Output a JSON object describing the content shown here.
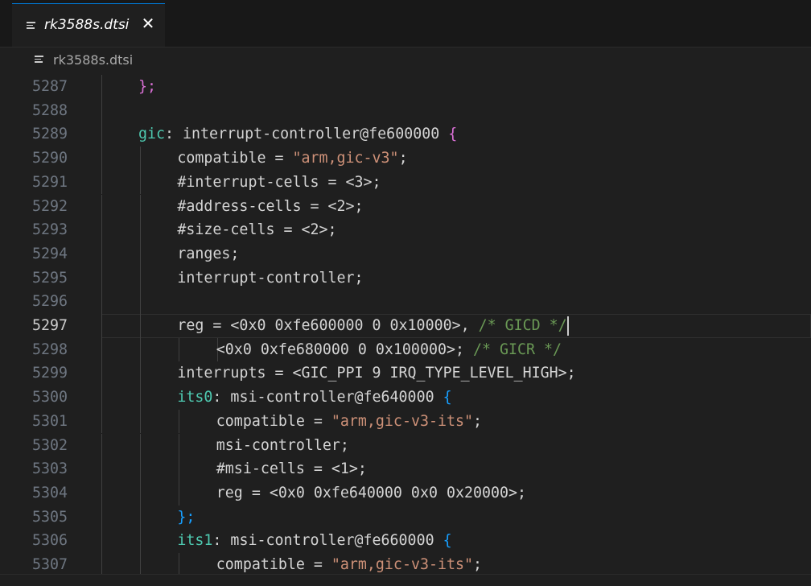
{
  "tab": {
    "label": "rk3588s.dtsi",
    "close_glyph": "✕",
    "icon": "lines-file-icon"
  },
  "breadcrumb": {
    "label": "rk3588s.dtsi",
    "icon": "lines-file-icon"
  },
  "editor": {
    "current_line": "5297",
    "lines": [
      {
        "num": "5287",
        "segments": [
          {
            "t": "};",
            "c": "b2"
          }
        ]
      },
      {
        "num": "5288",
        "segments": []
      },
      {
        "num": "5289",
        "segments": [
          {
            "t": "gic",
            "c": "t-label"
          },
          {
            "t": ": interrupt-controller@fe600000 ",
            "c": "t-ident"
          },
          {
            "t": "{",
            "c": "b2"
          }
        ]
      },
      {
        "num": "5290",
        "segments": [
          {
            "t": "compatible = ",
            "c": "t-ident"
          },
          {
            "t": "\"arm,gic-v3\"",
            "c": "t-str"
          },
          {
            "t": ";",
            "c": "t-punct"
          }
        ]
      },
      {
        "num": "5291",
        "segments": [
          {
            "t": "#interrupt-cells = <3>;",
            "c": "t-ident"
          }
        ]
      },
      {
        "num": "5292",
        "segments": [
          {
            "t": "#address-cells = <2>;",
            "c": "t-ident"
          }
        ]
      },
      {
        "num": "5293",
        "segments": [
          {
            "t": "#size-cells = <2>;",
            "c": "t-ident"
          }
        ]
      },
      {
        "num": "5294",
        "segments": [
          {
            "t": "ranges;",
            "c": "t-ident"
          }
        ]
      },
      {
        "num": "5295",
        "segments": [
          {
            "t": "interrupt-controller;",
            "c": "t-ident"
          }
        ]
      },
      {
        "num": "5296",
        "segments": []
      },
      {
        "num": "5297",
        "segments": [
          {
            "t": "reg = <0x0 0xfe600000 0 0x10000>, ",
            "c": "t-ident"
          },
          {
            "t": "/* GICD */",
            "c": "t-comment"
          }
        ]
      },
      {
        "num": "5298",
        "segments": [
          {
            "t": "<0x0 0xfe680000 0 0x100000>; ",
            "c": "t-ident"
          },
          {
            "t": "/* GICR */",
            "c": "t-comment"
          }
        ]
      },
      {
        "num": "5299",
        "segments": [
          {
            "t": "interrupts = <GIC_PPI 9 IRQ_TYPE_LEVEL_HIGH>;",
            "c": "t-ident"
          }
        ]
      },
      {
        "num": "5300",
        "segments": [
          {
            "t": "its0",
            "c": "t-label"
          },
          {
            "t": ": msi-controller@fe640000 ",
            "c": "t-ident"
          },
          {
            "t": "{",
            "c": "b3"
          }
        ]
      },
      {
        "num": "5301",
        "segments": [
          {
            "t": "compatible = ",
            "c": "t-ident"
          },
          {
            "t": "\"arm,gic-v3-its\"",
            "c": "t-str"
          },
          {
            "t": ";",
            "c": "t-punct"
          }
        ]
      },
      {
        "num": "5302",
        "segments": [
          {
            "t": "msi-controller;",
            "c": "t-ident"
          }
        ]
      },
      {
        "num": "5303",
        "segments": [
          {
            "t": "#msi-cells = <1>;",
            "c": "t-ident"
          }
        ]
      },
      {
        "num": "5304",
        "segments": [
          {
            "t": "reg = <0x0 0xfe640000 0x0 0x20000>;",
            "c": "t-ident"
          }
        ]
      },
      {
        "num": "5305",
        "segments": [
          {
            "t": "};",
            "c": "b3"
          }
        ]
      },
      {
        "num": "5306",
        "segments": [
          {
            "t": "its1",
            "c": "t-label"
          },
          {
            "t": ": msi-controller@fe660000 ",
            "c": "t-ident"
          },
          {
            "t": "{",
            "c": "b3"
          }
        ]
      },
      {
        "num": "5307",
        "segments": [
          {
            "t": "compatible = ",
            "c": "t-ident"
          },
          {
            "t": "\"arm,gic-v3-its\"",
            "c": "t-str"
          },
          {
            "t": ";",
            "c": "t-punct"
          }
        ]
      }
    ]
  },
  "colors": {
    "background": "#1f1f1f",
    "label": "#4ec9b0",
    "string": "#ce9178",
    "comment": "#6a9955",
    "bracket_magenta": "#da70d6",
    "bracket_blue": "#179fff",
    "tab_accent": "#0078d4"
  }
}
